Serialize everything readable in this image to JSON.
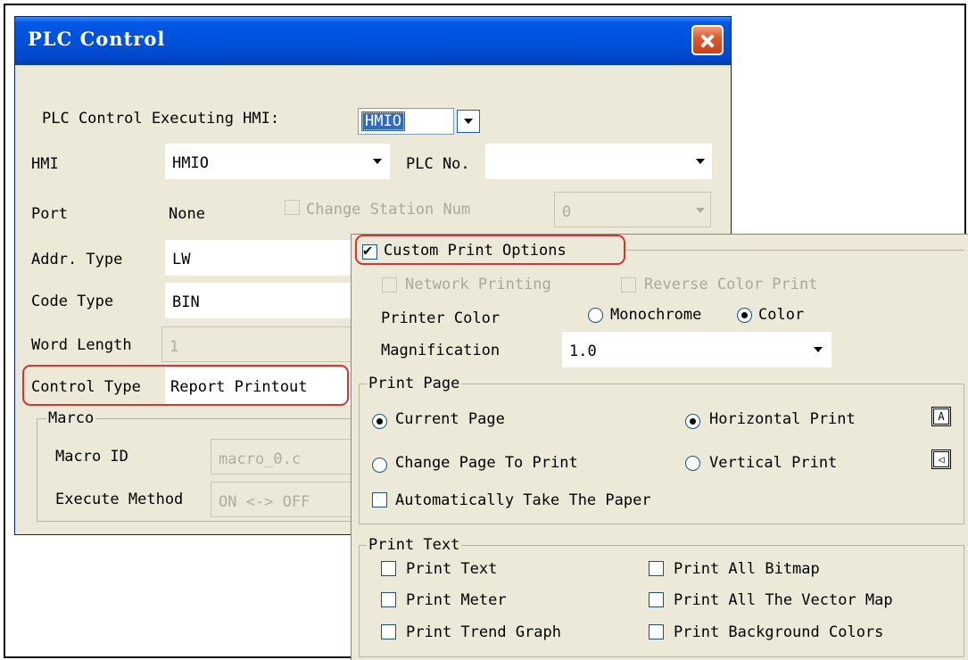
{
  "dialog": {
    "title": "PLC Control",
    "exec_hmi_label": "PLC Control Executing HMI:",
    "exec_hmi_value": "HMIO",
    "hmi_label": "HMI",
    "hmi_value": "HMIO",
    "plc_no_label": "PLC No.",
    "plc_no_value": "",
    "port_label": "Port",
    "port_value": "None",
    "change_station_label": "Change Station Num",
    "station_value": "0",
    "addr_type_label": "Addr. Type",
    "addr_type_value": "LW",
    "code_type_label": "Code Type",
    "code_type_value": "BIN",
    "word_length_label": "Word Length",
    "word_length_value": "1",
    "control_type_label": "Control Type",
    "control_type_value": "Report Printout",
    "marco_group": "Marco",
    "macro_id_label": "Macro ID",
    "macro_id_value": "macro_0.c",
    "execute_method_label": "Execute Method",
    "execute_method_value": "ON <-> OFF"
  },
  "print": {
    "custom_options_label": "Custom Print Options",
    "custom_options_checked": true,
    "network_printing": "Network Printing",
    "reverse_color": "Reverse Color Print",
    "printer_color_label": "Printer Color",
    "monochrome": "Monochrome",
    "color": "Color",
    "printer_color_selected": "Color",
    "magnification_label": "Magnification",
    "magnification_value": "1.0",
    "print_page_group": "Print Page",
    "current_page": "Current Page",
    "change_page": "Change Page To Print",
    "horizontal_print": "Horizontal Print",
    "vertical_print": "Vertical Print",
    "auto_paper": "Automatically Take The Paper",
    "print_text_group": "Print Text",
    "print_text": "Print Text",
    "print_meter": "Print Meter",
    "print_trend": "Print Trend Graph",
    "print_bitmap": "Print All Bitmap",
    "print_vector": "Print All The Vector Map",
    "print_bg": "Print Background Colors"
  },
  "colors": {
    "title_bar": "#0054e3",
    "highlight": "#e03030",
    "dialog_bg": "#ece9d8"
  }
}
